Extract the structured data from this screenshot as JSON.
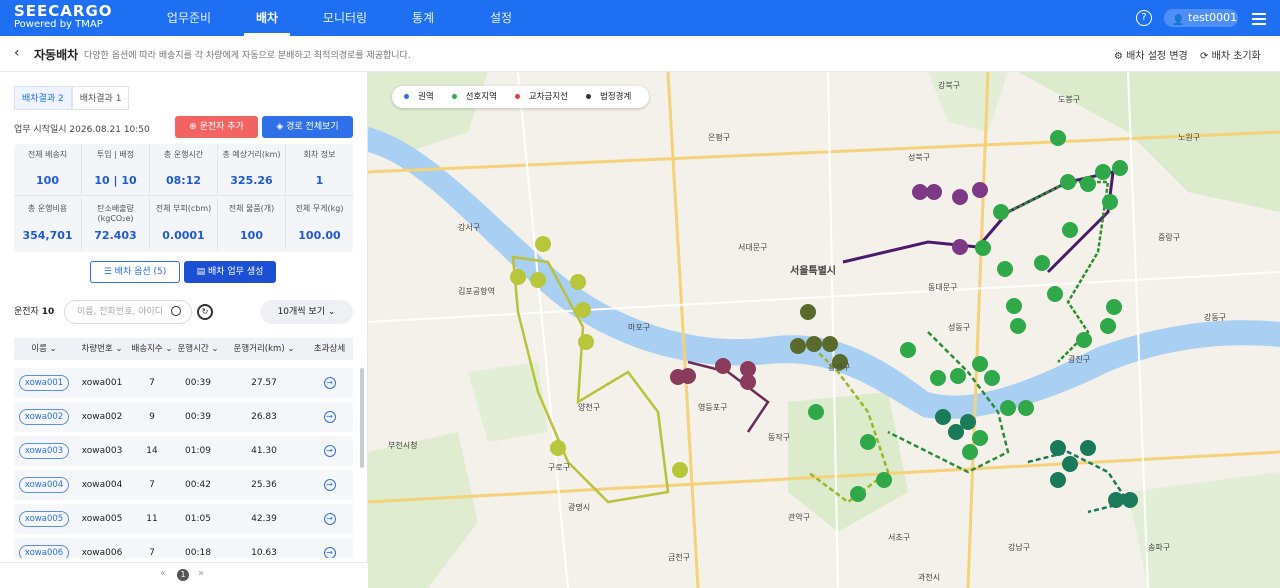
{
  "app": {
    "logo_line1": "SEECARGO",
    "logo_line2": "Powered by TMAP"
  },
  "nav": [
    {
      "label": "업무준비",
      "active": false
    },
    {
      "label": "배차",
      "active": true
    },
    {
      "label": "모니터링",
      "active": false
    },
    {
      "label": "통계",
      "active": false
    },
    {
      "label": "설정",
      "active": false
    }
  ],
  "user": {
    "name": "test0001",
    "help": "?"
  },
  "subheader": {
    "back": "‹",
    "title": "자동배차",
    "desc": "다양한 옵션에 따라 배송지를 각 차량에게 자동으로 분배하고 최적의경로를 제공합니다.",
    "settings_btn": "배차 설정 변경",
    "reset_btn": "배차 초기화"
  },
  "panel": {
    "tabs": [
      {
        "label": "배차결과 2",
        "active": true
      },
      {
        "label": "배차결과 1",
        "active": false
      }
    ],
    "start_label": "업무 시작일시",
    "start_value": "2026.08.21 10:50",
    "add_driver_btn": "운전자 추가",
    "route_view_btn": "경로 전체보기",
    "stats_row1": [
      {
        "label": "전체 배송지",
        "value": "100"
      },
      {
        "label": "투입 | 배정",
        "value": "10 | 10"
      },
      {
        "label": "총 운행시간",
        "value": "08:12"
      },
      {
        "label": "총 예상거리(km)",
        "value": "325.26"
      },
      {
        "label": "회차 정보",
        "value": "1"
      }
    ],
    "stats_row2": [
      {
        "label": "총 운행비용",
        "value": "354,701"
      },
      {
        "label": "탄소배출량 (kgCO₂e)",
        "value": "72.403"
      },
      {
        "label": "전체 부피(cbm)",
        "value": "0.0001"
      },
      {
        "label": "전체 물품(개)",
        "value": "100"
      },
      {
        "label": "전체 무게(kg)",
        "value": "100.00"
      }
    ],
    "option_btn": "배차 옵션 (5)",
    "generate_btn": "배차 업무 생성",
    "drivers_label": "운전자",
    "drivers_count": "10",
    "search_placeholder": "이름, 전화번호, 아이디",
    "view_select": "10개씩 보기",
    "columns": [
      "이름",
      "차량번호",
      "배송지수",
      "운행시간",
      "운행거리(km)",
      "초과상세"
    ],
    "rows": [
      {
        "id": "xowa001",
        "vehicle": "xowa001",
        "stops": "7",
        "time": "00:39",
        "dist": "27.57"
      },
      {
        "id": "xowa002",
        "vehicle": "xowa002",
        "stops": "9",
        "time": "00:39",
        "dist": "26.83"
      },
      {
        "id": "xowa003",
        "vehicle": "xowa003",
        "stops": "14",
        "time": "01:09",
        "dist": "41.30"
      },
      {
        "id": "xowa004",
        "vehicle": "xowa004",
        "stops": "7",
        "time": "00:42",
        "dist": "25.36"
      },
      {
        "id": "xowa005",
        "vehicle": "xowa005",
        "stops": "11",
        "time": "01:05",
        "dist": "42.39"
      },
      {
        "id": "xowa006",
        "vehicle": "xowa006",
        "stops": "7",
        "time": "00:18",
        "dist": "10.63"
      }
    ],
    "pager": {
      "prev": "«",
      "page": "1",
      "next": "»"
    }
  },
  "map": {
    "legend": [
      {
        "label": "권역",
        "color": "#2f6fe8"
      },
      {
        "label": "선호지역",
        "color": "#2bb24c"
      },
      {
        "label": "교차금지선",
        "color": "#e83b3b"
      },
      {
        "label": "법정경계",
        "color": "#333333"
      }
    ],
    "labels": [
      "서울특별시",
      "강북구",
      "도봉구",
      "노원구",
      "성북구",
      "동대문구",
      "중랑구",
      "광진구",
      "성동구",
      "용산구",
      "서초구",
      "강남구",
      "송파구",
      "강동구",
      "마포구",
      "서대문구",
      "은평구",
      "양천구",
      "강서구",
      "구로구",
      "금천구",
      "영등포구",
      "동작구",
      "관악구",
      "김포공항역",
      "부천시청",
      "광명시",
      "과천시"
    ]
  }
}
